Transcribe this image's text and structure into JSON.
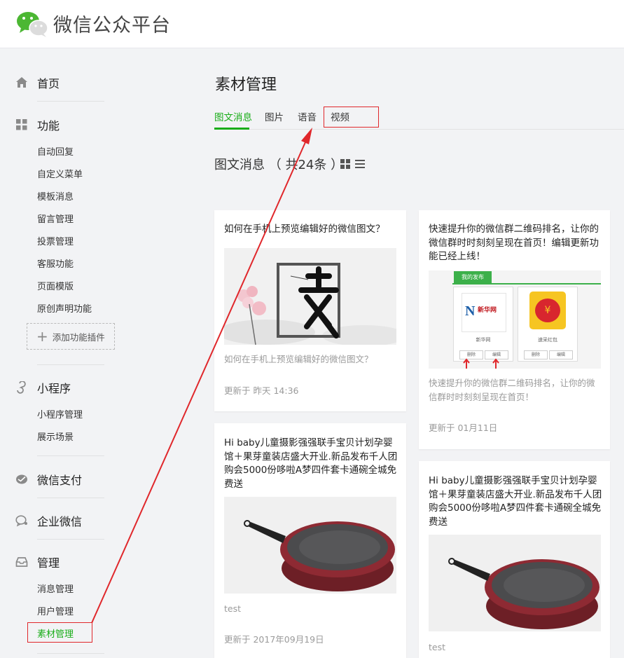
{
  "header": {
    "title": "微信公众平台"
  },
  "sidebar": {
    "home": "首页",
    "features": {
      "label": "功能",
      "items": [
        "自动回复",
        "自定义菜单",
        "模板消息",
        "留言管理",
        "投票管理",
        "客服功能",
        "页面模版",
        "原创声明功能"
      ],
      "add_plugin": "添加功能插件"
    },
    "miniprogram": {
      "label": "小程序",
      "items": [
        "小程序管理",
        "展示场景"
      ]
    },
    "pay": "微信支付",
    "work": "企业微信",
    "manage": {
      "label": "管理",
      "items": [
        "消息管理",
        "用户管理",
        "素材管理"
      ]
    }
  },
  "main": {
    "title": "素材管理",
    "tabs": [
      "图文消息",
      "图片",
      "语音",
      "视频"
    ],
    "section_title": "图文消息 （ 共24条 ）",
    "cards": [
      {
        "title": "如何在手机上预览编辑好的微信图文？",
        "desc": "如何在手机上预览编辑好的微信图文？",
        "date": "更新于 昨天 14:36"
      },
      {
        "title": "快速提升你的微信群二维码排名，让你的微信群时时刻刻呈现在首页！编辑更新功能已经上线！",
        "desc": "快速提升你的微信群二维码排名，让你的微信群时时刻刻呈现在首页！",
        "date": "更新于 01月11日",
        "img_header": "我的发布",
        "img_items": [
          "新华网",
          "速采红包"
        ],
        "img_buttons": [
          "删除",
          "编辑"
        ]
      },
      {
        "title": "Hi baby儿童摄影强强联手宝贝计划孕婴馆＋果芽童装店盛大开业.新品发布千人团购会5000份哆啦A梦四件套卡通碗全城免费送",
        "desc": "test",
        "date": "更新于 2017年09月19日"
      },
      {
        "title": "Hi baby儿童摄影强强联手宝贝计划孕婴馆＋果芽童装店盛大开业.新品发布千人团购会5000份哆啦A梦四件套卡通碗全城免费送",
        "desc": "test",
        "date": ""
      }
    ]
  },
  "colors": {
    "accent": "#1aad19",
    "annotation": "#e0272b"
  }
}
